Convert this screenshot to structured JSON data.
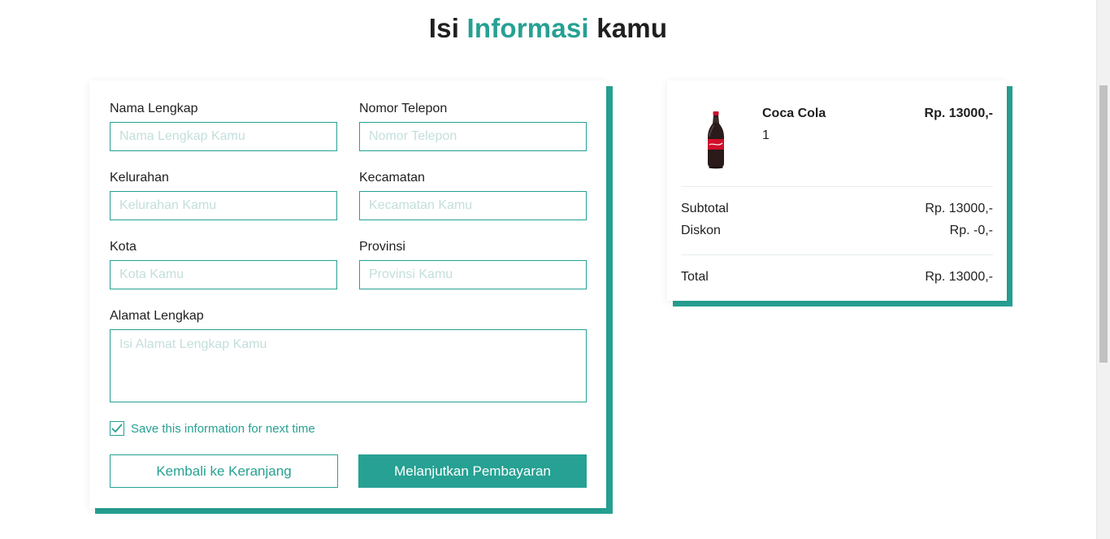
{
  "heading": {
    "part1": "Isi",
    "accent": "Informasi",
    "part2": "kamu"
  },
  "colors": {
    "accent": "#26a193",
    "placeholder": "#c3dfdb",
    "text": "#1f1f1f"
  },
  "form": {
    "fields": [
      {
        "label": "Nama Lengkap",
        "placeholder": "Nama Lengkap Kamu",
        "value": ""
      },
      {
        "label": "Nomor Telepon",
        "placeholder": "Nomor Telepon",
        "value": ""
      },
      {
        "label": "Kelurahan",
        "placeholder": "Kelurahan Kamu",
        "value": ""
      },
      {
        "label": "Kecamatan",
        "placeholder": "Kecamatan Kamu",
        "value": ""
      },
      {
        "label": "Kota",
        "placeholder": "Kota Kamu",
        "value": ""
      },
      {
        "label": "Provinsi",
        "placeholder": "Provinsi Kamu",
        "value": ""
      }
    ],
    "address": {
      "label": "Alamat Lengkap",
      "placeholder": "Isi Alamat Lengkap Kamu"
    },
    "save_info": {
      "label": "Save this information for next time",
      "checked": true
    },
    "back_button": "Kembali ke Keranjang",
    "continue_button": "Melanjutkan Pembayaran"
  },
  "summary": {
    "item": {
      "name": "Coca Cola",
      "quantity": "1",
      "price": "Rp. 13000,-",
      "image_icon": "coca-cola-bottle-image"
    },
    "subtotal_label": "Subtotal",
    "subtotal_value": "Rp. 13000,-",
    "discount_label": "Diskon",
    "discount_value": "Rp. -0,-",
    "total_label": "Total",
    "total_value": "Rp. 13000,-"
  }
}
